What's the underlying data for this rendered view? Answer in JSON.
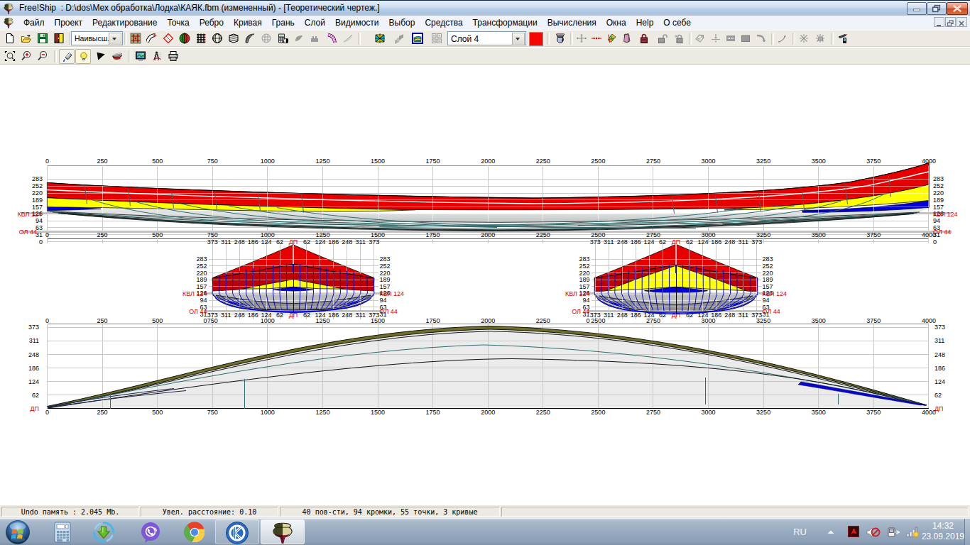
{
  "window": {
    "title": "Free!Ship  : D:\\dos\\Мех обработка\\Лодка\\КАЯК.fbm (измененный) - [Теоретический чертеж.]",
    "controls": {
      "minimize": "minimize",
      "restore": "restore",
      "close": "close"
    }
  },
  "menu": {
    "items": [
      "Файл",
      "Проект",
      "Редактирование",
      "Точка",
      "Ребро",
      "Кривая",
      "Грань",
      "Слой",
      "Видимости",
      "Выбор",
      "Средства",
      "Трансформации",
      "Вычисления",
      "Окна",
      "Help",
      "О себе"
    ]
  },
  "toolbar": {
    "precision_combo": "Наивысш.",
    "layer_combo": "Слой 4",
    "layer_color": "#f50800",
    "row1_icons": [
      "new-document",
      "open-folder",
      "save-file",
      "exit-door",
      "control-net",
      "control-curves",
      "interior-edges",
      "both-sides",
      "stations-grid",
      "buttocks-globe",
      "waterlines-box",
      "diagonals-shell",
      "grid-sphere",
      "hydrostatics-calculator",
      "flowlines",
      "resistance",
      "curvature",
      "developable",
      "normals",
      "planes",
      "layer-colors",
      "zebra-shading",
      "perspective-pawn",
      "move-point",
      "align-points",
      "project-points",
      "mirror-pages",
      "lock-points",
      "unlock-points",
      "lock-all",
      "new-face",
      "split-edge",
      "collapse-edge",
      "edge-box",
      "insert-plane",
      "intersect-curve",
      "remove-point",
      "remove-face",
      "knife-cut"
    ],
    "row2_icons": [
      "zoom-extents",
      "zoom-in",
      "zoom-out",
      "pen-mode",
      "bulb-wireframe",
      "shade-triangle",
      "developed-hull",
      "save-image",
      "measure-model",
      "print"
    ]
  },
  "drawing": {
    "profile_x_labels": [
      "0",
      "250",
      "500",
      "750",
      "1000",
      "1250",
      "1500",
      "1750",
      "2000",
      "2250",
      "2500",
      "2750",
      "3000",
      "3250",
      "3500",
      "3750",
      "4000"
    ],
    "profile_y_labels": [
      "283",
      "252",
      "220",
      "189",
      "157",
      "126",
      "94",
      "63",
      "31",
      "0"
    ],
    "profile_y_values": [
      283,
      252,
      220,
      189,
      157,
      126,
      94,
      63,
      31,
      0
    ],
    "body_x_labels": [
      "373",
      "311",
      "248",
      "186",
      "124",
      "62",
      "ДП",
      "62",
      "124",
      "186",
      "248",
      "311",
      "373"
    ],
    "body_y_labels": [
      "283",
      "252",
      "220",
      "189",
      "157",
      "126",
      "94",
      "63",
      "31"
    ],
    "body_y_values": [
      283,
      252,
      220,
      189,
      157,
      126,
      94,
      63,
      31
    ],
    "plan_y_labels": [
      "373",
      "311",
      "248",
      "186",
      "124",
      "62"
    ],
    "plan_y_values": [
      373,
      311,
      248,
      186,
      124,
      62
    ],
    "kvl_label": "КВЛ 124",
    "ol_label": "ОЛ 44",
    "dp_label": "ДП",
    "zero_label": "0"
  },
  "status_bar": {
    "panel1": "Undo память : 2.045 Mb.",
    "panel2": "Увел. расстояние: 0.10",
    "panel3": "40 пов-сти, 94 кромки, 55 точки, 3 кривые"
  },
  "taskbar": {
    "start": "start-orb",
    "apps": [
      "calculator",
      "download-master",
      "viber",
      "chrome",
      "kompas",
      "freeship"
    ],
    "tray": {
      "language": "RU",
      "icons": [
        "hidden-icons-arrow",
        "adobe-acrobat",
        "volume-muted",
        "safely-remove",
        "network-signal"
      ],
      "time": "14:32",
      "date": "23.09.2019"
    }
  }
}
